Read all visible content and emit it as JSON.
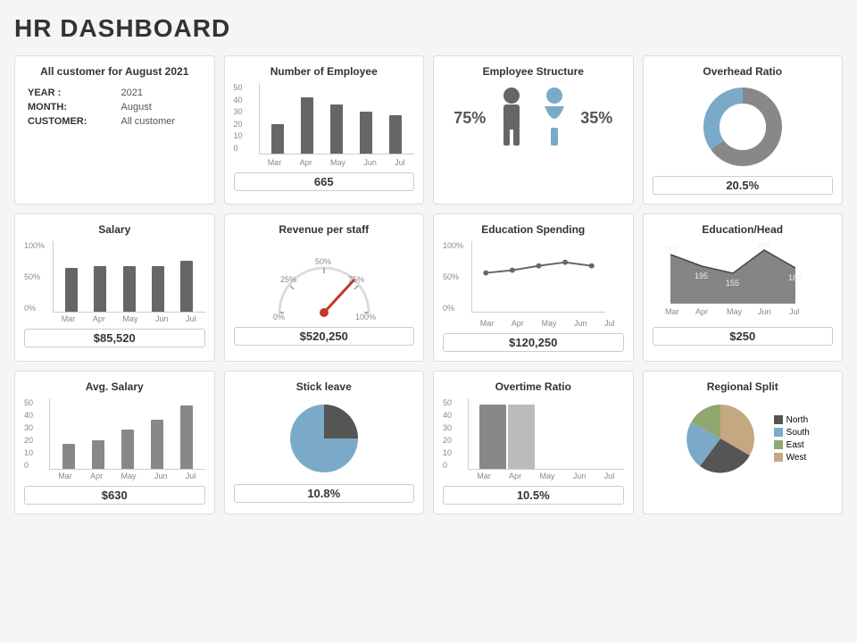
{
  "title": "HR DASHBOARD",
  "rows": [
    {
      "cards": [
        {
          "id": "all-customer",
          "title": "All customer for August 2021",
          "fields": [
            {
              "label": "YEAR :",
              "value": "2021"
            },
            {
              "label": "MONTH:",
              "value": "August"
            },
            {
              "label": "CUSTOMER:",
              "value": "All customer"
            }
          ],
          "valueLabel": null
        },
        {
          "id": "num-employee",
          "title": "Number of Employee",
          "months": [
            "Mar",
            "Apr",
            "May",
            "Jun",
            "Jul"
          ],
          "bars": [
            26,
            40,
            35,
            30,
            27
          ],
          "maxY": 50,
          "yLabels": [
            "50",
            "40",
            "30",
            "20",
            "10",
            "0"
          ],
          "valueLabel": "665"
        },
        {
          "id": "emp-structure",
          "title": "Employee Structure",
          "male_pct": "75%",
          "female_pct": "35%",
          "valueLabel": null
        },
        {
          "id": "overhead-ratio",
          "title": "Overhead Ratio",
          "valueLabel": "20.5%"
        }
      ]
    },
    {
      "cards": [
        {
          "id": "salary",
          "title": "Salary",
          "months": [
            "Mar",
            "Apr",
            "May",
            "Jun",
            "Jul"
          ],
          "bars": [
            62,
            65,
            65,
            65,
            70
          ],
          "yLabels": [
            "100%",
            "50%",
            "0%"
          ],
          "valueLabel": "$85,520"
        },
        {
          "id": "revenue-per-staff",
          "title": "Revenue per staff",
          "percent": "50%",
          "labels": [
            "0%",
            "25%",
            "50%",
            "75%",
            "100%"
          ],
          "needle": 68,
          "valueLabel": "$520,250"
        },
        {
          "id": "education-spending",
          "title": "Education Spending",
          "months": [
            "Mar",
            "Apr",
            "May",
            "Jun",
            "Jul"
          ],
          "points": [
            55,
            58,
            65,
            70,
            65
          ],
          "yLabels": [
            "100%",
            "50%",
            "0%"
          ],
          "valueLabel": "$120,250"
        },
        {
          "id": "education-head",
          "title": "Education/Head",
          "months": [
            "Mar",
            "Apr",
            "May",
            "Jun",
            "Jul"
          ],
          "values": [
            250,
            195,
            155,
            275,
            185
          ],
          "valueLabel": "$250"
        }
      ]
    },
    {
      "cards": [
        {
          "id": "avg-salary",
          "title": "Avg. Salary",
          "months": [
            "Mar",
            "Apr",
            "May",
            "Jun",
            "Jul"
          ],
          "bars": [
            18,
            20,
            28,
            35,
            45
          ],
          "yLabels": [
            "50",
            "40",
            "30",
            "20",
            "10",
            "0"
          ],
          "valueLabel": "$630"
        },
        {
          "id": "stick-leave",
          "title": "Stick leave",
          "valueLabel": "10.8%"
        },
        {
          "id": "overtime-ratio",
          "title": "Overtime Ratio",
          "months": [
            "Mar",
            "Apr",
            "May",
            "Jun",
            "Jul"
          ],
          "bars": [
            45,
            45,
            0,
            0,
            0
          ],
          "yLabels": [
            "50",
            "40",
            "30",
            "20",
            "10",
            "0"
          ],
          "valueLabel": "10.5%"
        },
        {
          "id": "regional-split",
          "title": "Regional Split",
          "segments": [
            {
              "label": "North",
              "color": "#555",
              "pct": 30
            },
            {
              "label": "South",
              "color": "#8fafc8",
              "pct": 20
            },
            {
              "label": "East",
              "color": "#8fa870",
              "pct": 15
            },
            {
              "label": "West",
              "color": "#c4a882",
              "pct": 35
            }
          ],
          "valueLabel": null
        }
      ]
    }
  ]
}
